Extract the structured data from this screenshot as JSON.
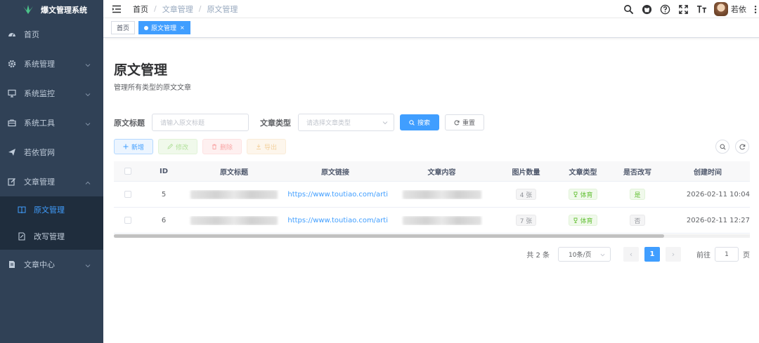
{
  "app": {
    "title": "爆文管理系统"
  },
  "sidebar": {
    "items": [
      {
        "label": "首页",
        "icon": "dashboard-icon"
      },
      {
        "label": "系统管理",
        "icon": "gear-icon"
      },
      {
        "label": "系统监控",
        "icon": "monitor-icon"
      },
      {
        "label": "系统工具",
        "icon": "toolbox-icon"
      },
      {
        "label": "若依官网",
        "icon": "paper-plane-icon"
      },
      {
        "label": "文章管理",
        "icon": "edit-icon"
      },
      {
        "label": "文章中心",
        "icon": "document-icon"
      }
    ],
    "subitems": [
      {
        "label": "原文管理",
        "icon": "book-icon"
      },
      {
        "label": "改写管理",
        "icon": "rewrite-icon"
      }
    ]
  },
  "breadcrumb": {
    "items": [
      "首页",
      "文章管理",
      "原文管理"
    ],
    "separator": "/"
  },
  "user": {
    "name": "若依"
  },
  "tags": [
    {
      "label": "首页"
    },
    {
      "label": "原文管理",
      "close": "×"
    }
  ],
  "page": {
    "title": "原文管理",
    "subtitle": "管理所有类型的原文文章"
  },
  "search": {
    "title_label": "原文标题",
    "title_placeholder": "请输入原文标题",
    "type_label": "文章类型",
    "type_placeholder": "请选择文章类型",
    "search_button": "搜索",
    "reset_button": "重置"
  },
  "toolbar": {
    "add": "新增",
    "edit": "修改",
    "delete": "删除",
    "export": "导出"
  },
  "table": {
    "headers": [
      "ID",
      "原文标题",
      "原文链接",
      "文章内容",
      "图片数量",
      "文章类型",
      "是否改写",
      "创建时间"
    ],
    "rows": [
      {
        "id": "5",
        "link": "https://www.toutiao.com/arti",
        "images": "4 张",
        "type": "体育",
        "rewritten": "是",
        "created": "2026-02-11 10:04"
      },
      {
        "id": "6",
        "link": "https://www.toutiao.com/arti",
        "images": "7 张",
        "type": "体育",
        "rewritten": "否",
        "created": "2026-02-11 12:27"
      }
    ]
  },
  "pagination": {
    "total": "共 2 条",
    "page_size": "10条/页",
    "current": "1",
    "goto_label": "前往",
    "goto_value": "1",
    "page_unit": "页"
  },
  "colors": {
    "sidebar_bg": "#304156",
    "sidebar_sub_bg": "#1f2d3d",
    "accent": "#409eff",
    "success": "#67c23a"
  }
}
